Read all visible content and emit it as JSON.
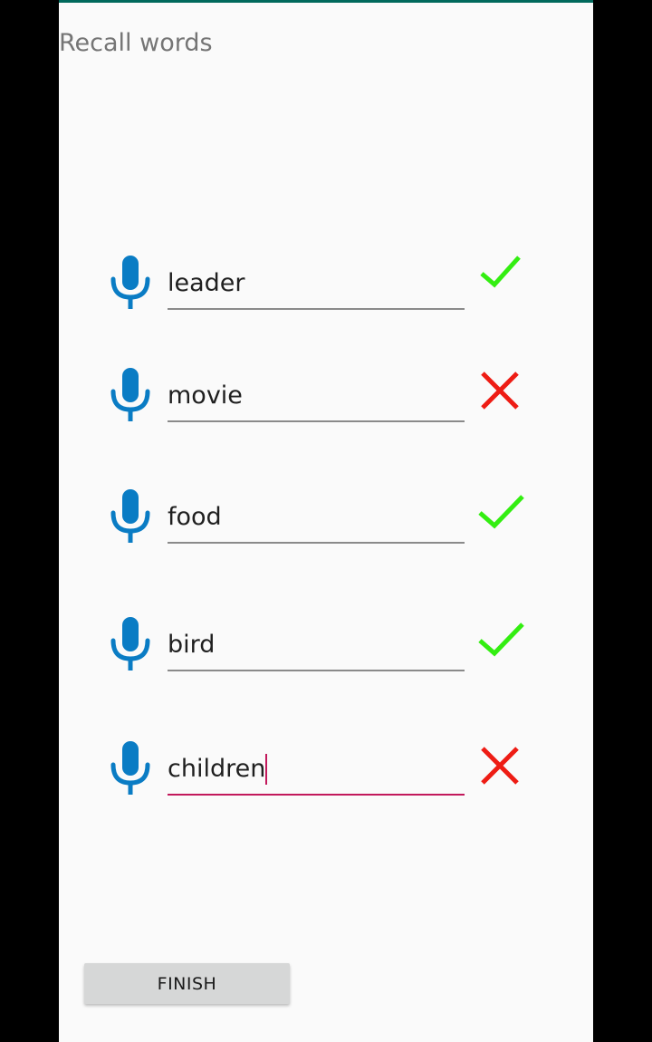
{
  "screen": {
    "title": "Recall words"
  },
  "colors": {
    "mic": "#0a7cc4",
    "correct": "#33ee11",
    "wrong": "#ee1c14",
    "accent": "#c2185b"
  },
  "words": [
    {
      "value": "leader",
      "result": "correct",
      "mic_icon": "microphone-icon",
      "status_icon": "checkmark-icon"
    },
    {
      "value": "movie",
      "result": "wrong",
      "mic_icon": "microphone-icon",
      "status_icon": "cross-icon"
    },
    {
      "value": "food",
      "result": "correct",
      "mic_icon": "microphone-icon",
      "status_icon": "checkmark-icon"
    },
    {
      "value": "bird",
      "result": "correct",
      "mic_icon": "microphone-icon",
      "status_icon": "checkmark-icon"
    },
    {
      "value": "children",
      "result": "wrong",
      "mic_icon": "microphone-icon",
      "status_icon": "cross-icon",
      "focused": true
    }
  ],
  "finish_label": "FINISH"
}
